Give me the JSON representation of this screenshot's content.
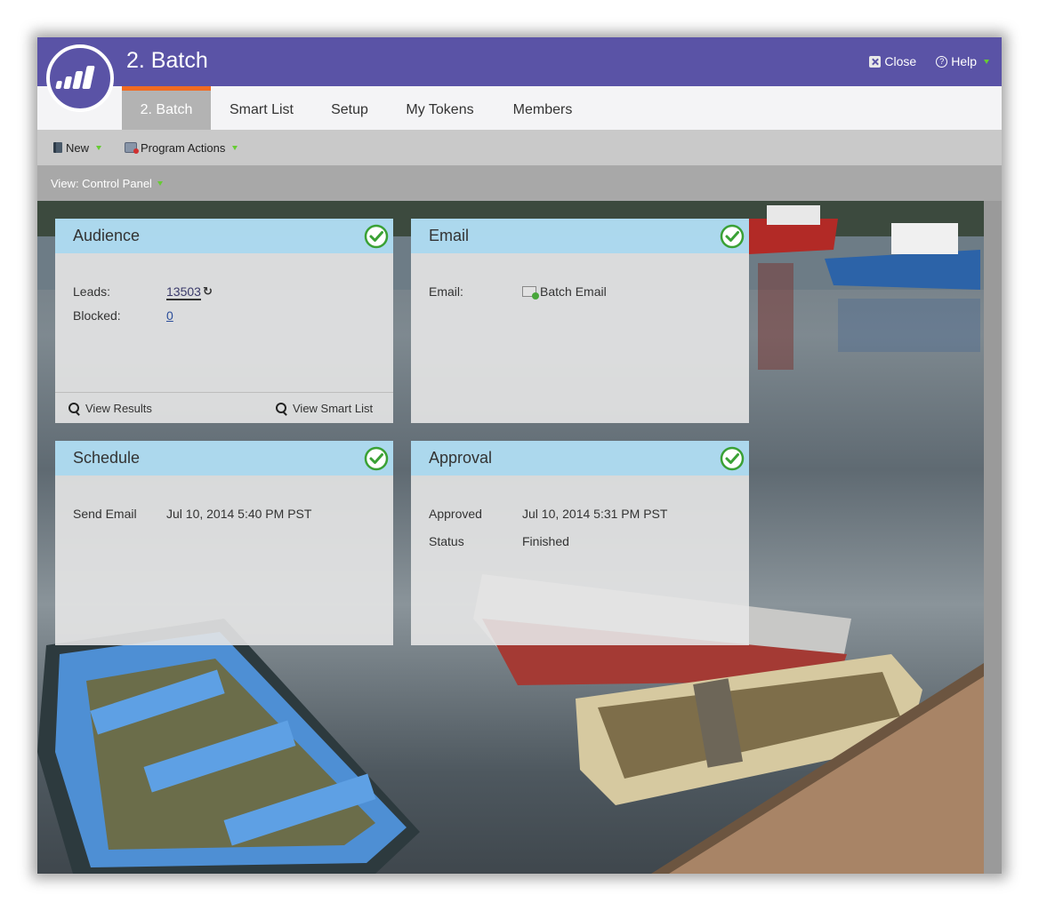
{
  "window": {
    "title": "2. Batch",
    "close_label": "Close",
    "help_label": "Help"
  },
  "tabs": [
    {
      "label": "2. Batch",
      "active": true
    },
    {
      "label": "Smart List",
      "active": false
    },
    {
      "label": "Setup",
      "active": false
    },
    {
      "label": "My Tokens",
      "active": false
    },
    {
      "label": "Members",
      "active": false
    }
  ],
  "toolbar": {
    "new_label": "New",
    "program_actions_label": "Program Actions"
  },
  "view": {
    "label": "View: Control Panel"
  },
  "cards": {
    "audience": {
      "title": "Audience",
      "leads_label": "Leads:",
      "leads_value": "13503",
      "blocked_label": "Blocked:",
      "blocked_value": "0",
      "view_results": "View Results",
      "view_smart_list": "View Smart List"
    },
    "email": {
      "title": "Email",
      "email_label": "Email:",
      "email_value": "Batch Email"
    },
    "schedule": {
      "title": "Schedule",
      "send_label": "Send Email",
      "send_value": "Jul 10, 2014 5:40 PM PST"
    },
    "approval": {
      "title": "Approval",
      "approved_label": "Approved",
      "approved_value": "Jul 10, 2014 5:31 PM PST",
      "status_label": "Status",
      "status_value": "Finished"
    }
  },
  "colors": {
    "brand_purple": "#5a53a6",
    "tab_accent": "#f26b21",
    "card_header": "#aad8ee",
    "check_green": "#3aa135"
  }
}
